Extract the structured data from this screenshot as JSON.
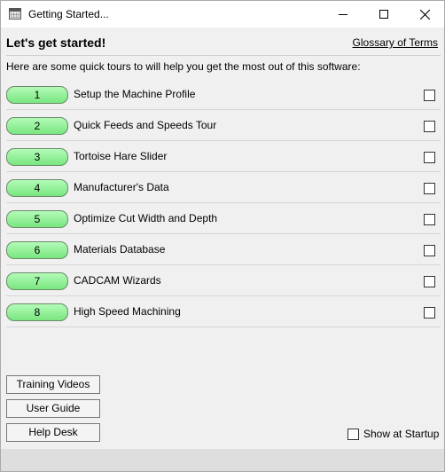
{
  "window": {
    "title": "Getting Started...",
    "icon": "app-grid-icon",
    "controls": [
      "minimize-icon",
      "maximize-icon",
      "close-icon"
    ]
  },
  "header": {
    "title": "Let's get started!",
    "glossary_link": "Glossary of Terms"
  },
  "intro": "Here are some quick tours to will help you get the most out of this software:",
  "tours": [
    {
      "number": "1",
      "label": "Setup the Machine Profile",
      "checked": false
    },
    {
      "number": "2",
      "label": "Quick Feeds and Speeds Tour",
      "checked": false
    },
    {
      "number": "3",
      "label": "Tortoise Hare Slider",
      "checked": false
    },
    {
      "number": "4",
      "label": "Manufacturer's Data",
      "checked": false
    },
    {
      "number": "5",
      "label": "Optimize Cut Width and Depth",
      "checked": false
    },
    {
      "number": "6",
      "label": "Materials Database",
      "checked": false
    },
    {
      "number": "7",
      "label": "CADCAM Wizards",
      "checked": false
    },
    {
      "number": "8",
      "label": "High Speed Machining",
      "checked": false
    }
  ],
  "buttons": {
    "training_videos": "Training Videos",
    "user_guide": "User Guide",
    "help_desk": "Help Desk"
  },
  "startup": {
    "label": "Show at Startup",
    "checked": false
  },
  "colors": {
    "tour_button_top": "#b3fbb8",
    "tour_button_bottom": "#79e67f"
  }
}
